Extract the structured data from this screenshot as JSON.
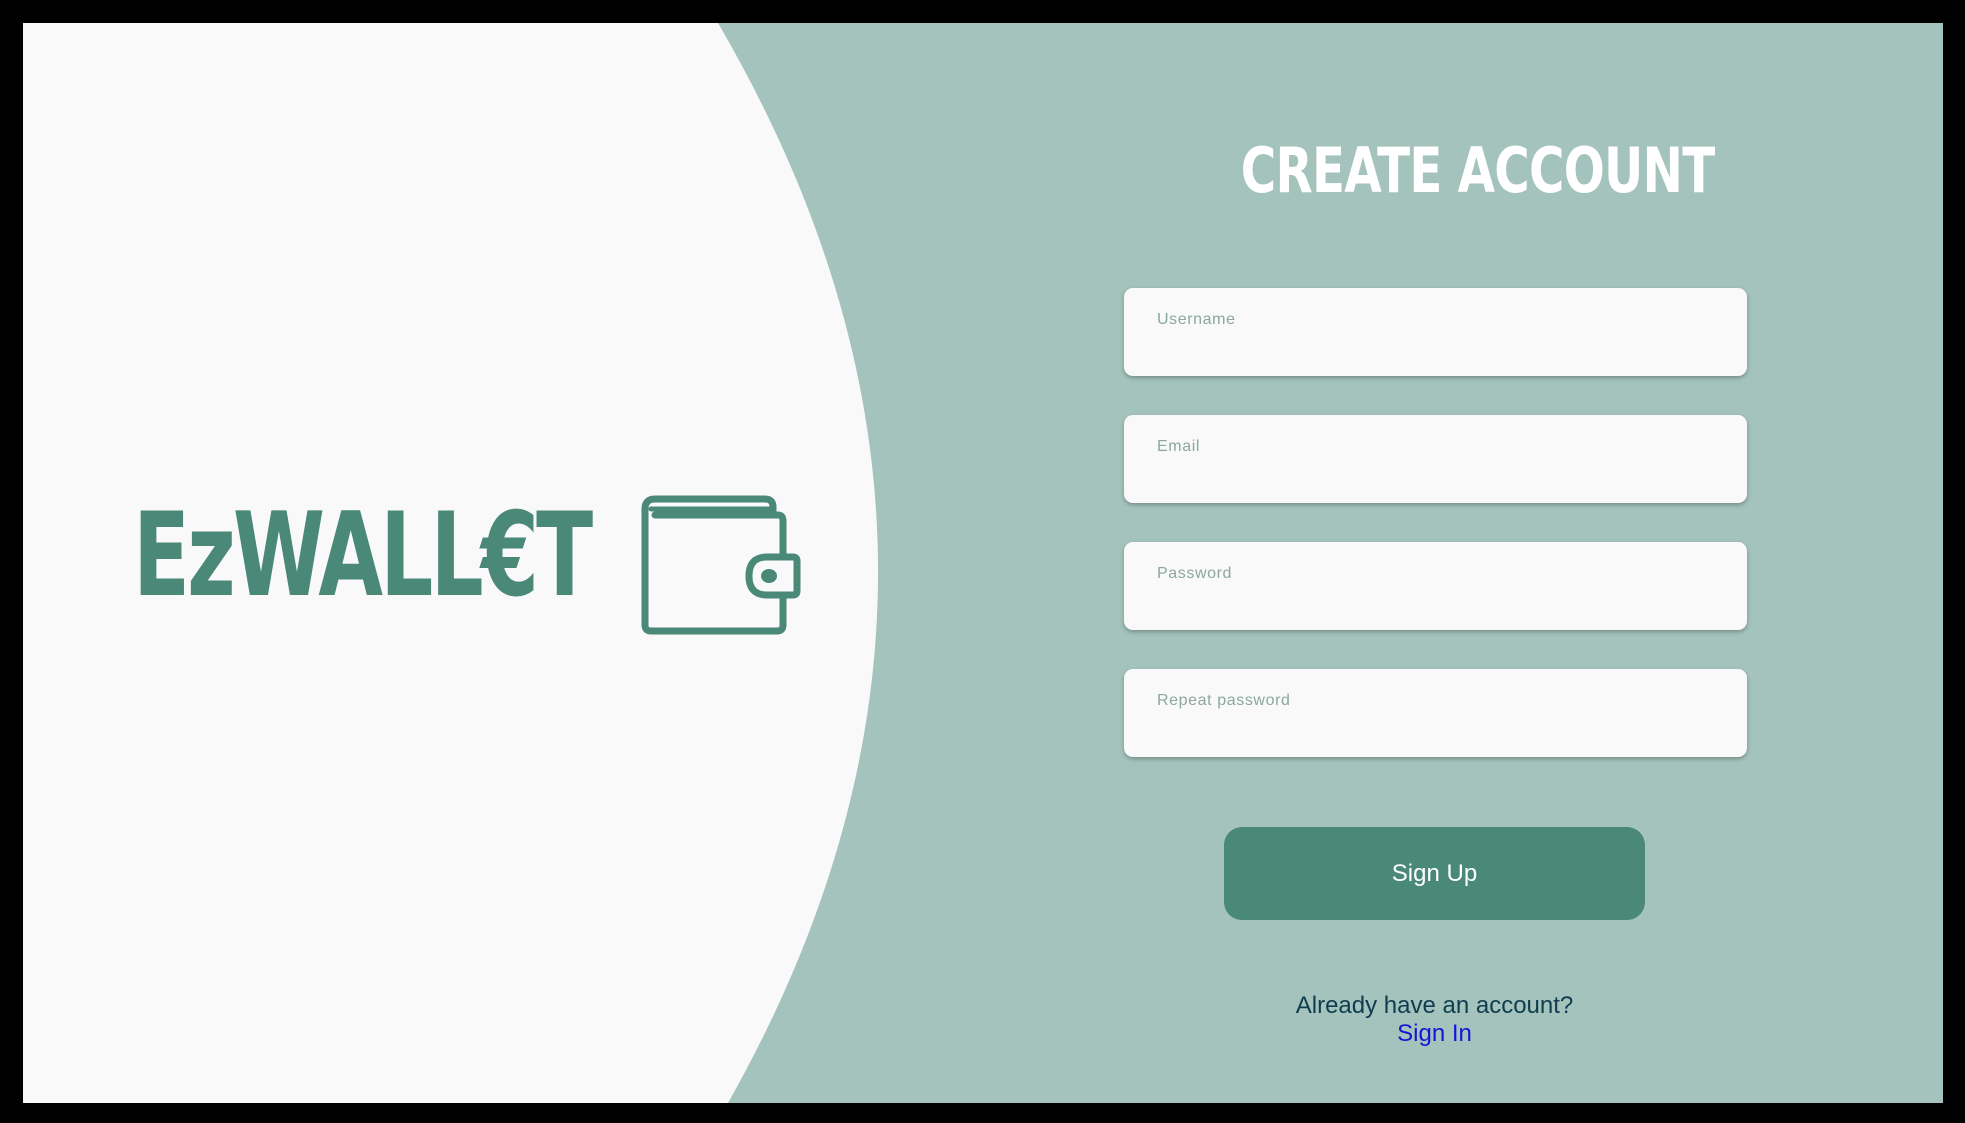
{
  "brand": {
    "name": "EzWALL€T",
    "icon": "wallet-icon"
  },
  "form": {
    "title": "CREATE ACCOUNT",
    "fields": [
      {
        "label": "Username",
        "value": ""
      },
      {
        "label": "Email",
        "value": ""
      },
      {
        "label": "Password",
        "value": ""
      },
      {
        "label": "Repeat password",
        "value": ""
      }
    ],
    "submit_label": "Sign Up",
    "prompt_text": "Already have an account?",
    "signin_label": "Sign In"
  },
  "colors": {
    "background_panel": "#a4c3bc",
    "left_panel": "#f9f9f9",
    "accent": "#4a8878",
    "field_label": "#8ca79f",
    "prompt_text": "#0f3d4f",
    "link": "#1515d6"
  }
}
